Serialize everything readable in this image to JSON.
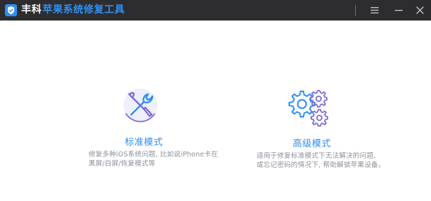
{
  "window": {
    "brand": "丰科",
    "product": "苹果系统修复工具"
  },
  "titlebar": {
    "menu_icon": "hamburger-menu-icon",
    "minimize_icon": "minimize-icon",
    "close_icon": "close-icon"
  },
  "modes": [
    {
      "icon": "tools-icon",
      "title": "标准模式",
      "desc_line1": "修复多种iOS系统问题, 比如说iPhone卡在",
      "desc_line2": "黑屏/白屏/恢复模式等"
    },
    {
      "icon": "gears-icon",
      "title": "高级模式",
      "desc_line1": "适用于修复标准模式下无法解决的问题,",
      "desc_line2": "或忘记密码的情况下, 帮助解锁苹果设备。"
    }
  ],
  "colors": {
    "titlebar_bg": "#2d2d30",
    "accent": "#2f8ef0",
    "purple": "#7b6cd8",
    "desc_text": "#8a8f99"
  }
}
